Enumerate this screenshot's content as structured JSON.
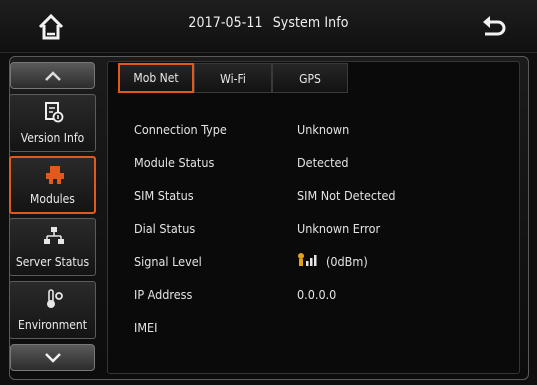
{
  "header": {
    "date": "2017-05-11",
    "title": "System Info"
  },
  "sidebar": {
    "items": [
      {
        "label": "Version Info",
        "icon": "document-icon"
      },
      {
        "label": "Modules",
        "icon": "modules-icon"
      },
      {
        "label": "Server Status",
        "icon": "network-icon"
      },
      {
        "label": "Environment",
        "icon": "thermometer-icon"
      }
    ],
    "active_index": 1
  },
  "tabs": [
    {
      "label": "Mob Net"
    },
    {
      "label": "Wi-Fi"
    },
    {
      "label": "GPS"
    }
  ],
  "active_tab": 0,
  "fields": [
    {
      "label": "Connection Type",
      "value": "Unknown"
    },
    {
      "label": "Module Status",
      "value": "Detected"
    },
    {
      "label": "SIM Status",
      "value": "SIM Not Detected"
    },
    {
      "label": "Dial Status",
      "value": "Unknown Error"
    },
    {
      "label": "Signal Level",
      "value": "(0dBm)"
    },
    {
      "label": "IP Address",
      "value": "0.0.0.0"
    },
    {
      "label": "IMEI",
      "value": ""
    }
  ],
  "colors": {
    "accent": "#e2591c",
    "background": "#0f0f0f",
    "text": "#e6e6e6"
  }
}
